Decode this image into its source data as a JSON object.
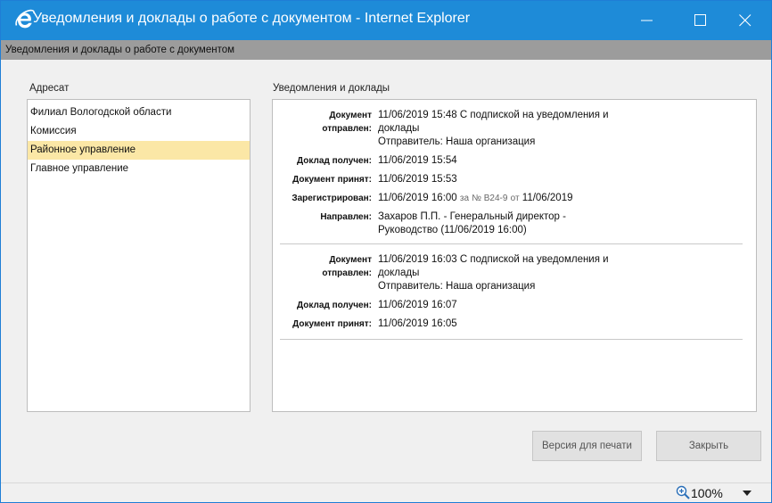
{
  "window": {
    "title": "Уведомления и доклады о работе с документом - Internet Explorer",
    "subtitle": "Уведомления и доклады о работе с документом"
  },
  "addressees": {
    "label": "Адресат",
    "items": [
      {
        "label": "Филиал Вологодской области",
        "selected": false
      },
      {
        "label": "Комиссия",
        "selected": false
      },
      {
        "label": "Районное управление",
        "selected": true
      },
      {
        "label": "Главное управление",
        "selected": false
      }
    ]
  },
  "reports": {
    "label": "Уведомления и доклады",
    "events": [
      {
        "sent_key": "Документ отправлен:",
        "sent_line1": "11/06/2019 15:48 С подпиской на уведомления и",
        "sent_line2": "доклады",
        "sent_line3": "Отправитель: Наша организация",
        "received_key": "Доклад получен:",
        "received_value": "11/06/2019 15:54",
        "accepted_key": "Документ принят:",
        "accepted_value": "11/06/2019 15:53",
        "registered_key": "Зарегистрирован:",
        "registered_time": "11/06/2019 16:00",
        "registered_for": "за",
        "registered_num": "№ B24-9",
        "registered_from": "от",
        "registered_date": "11/06/2019",
        "directed_key": "Направлен:",
        "directed_line1": "Захаров  П.П. - Генеральный директор -",
        "directed_line2": "Руководство (11/06/2019 16:00)"
      },
      {
        "sent_key": "Документ отправлен:",
        "sent_line1": "11/06/2019 16:03 С подпиской на уведомления и",
        "sent_line2": "доклады",
        "sent_line3": "Отправитель: Наша организация",
        "received_key": "Доклад получен:",
        "received_value": "11/06/2019 16:07",
        "accepted_key": "Документ принят:",
        "accepted_value": "11/06/2019 16:05"
      }
    ]
  },
  "buttons": {
    "print": "Версия для печати",
    "close": "Закрыть"
  },
  "status": {
    "zoom": "100%",
    "icons": {
      "zoom": "magnifier-plus-icon",
      "dropdown": "chevron-down-icon"
    }
  },
  "colors": {
    "titlebar": "#1e8bd8",
    "subbar": "#9c9c9c",
    "selected_row": "#fbe7a6",
    "content_bg": "#f0f0f0"
  }
}
